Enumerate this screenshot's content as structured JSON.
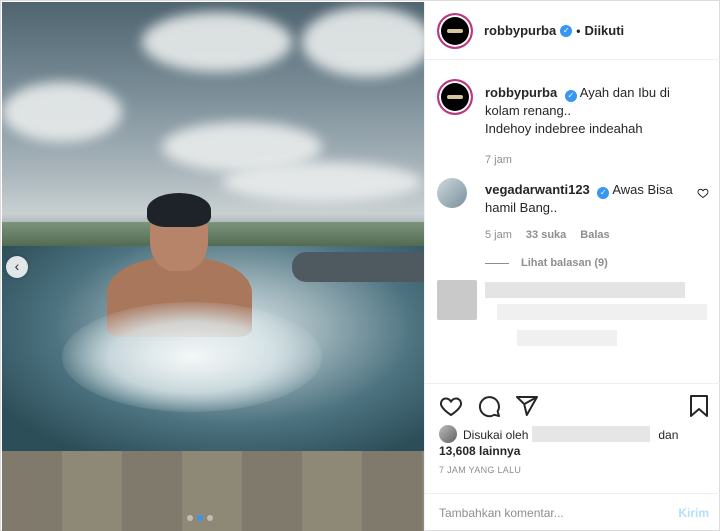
{
  "post": {
    "username": "robbypurba",
    "follow_status": "Diikuti",
    "caption": "Ayah dan Ibu di kolam renang..",
    "caption_line2": "Indehoy indebree indeahah",
    "caption_time": "7 jam"
  },
  "comment": {
    "username": "vegadarwanti123",
    "text": "Awas Bisa hamil Bang..",
    "time": "5 jam",
    "likes": "33 suka",
    "reply": "Balas",
    "see_replies": "Lihat balasan (9)"
  },
  "likes": {
    "prefix": "Disukai oleh",
    "and": "dan",
    "count": "13,608 lainnya"
  },
  "timestamp": "7 JAM YANG LALU",
  "add_comment": {
    "placeholder": "Tambahkan komentar...",
    "post_label": "Kirim"
  },
  "colors": {
    "accent": "#3897f0",
    "post_disabled": "#b2dffc"
  }
}
